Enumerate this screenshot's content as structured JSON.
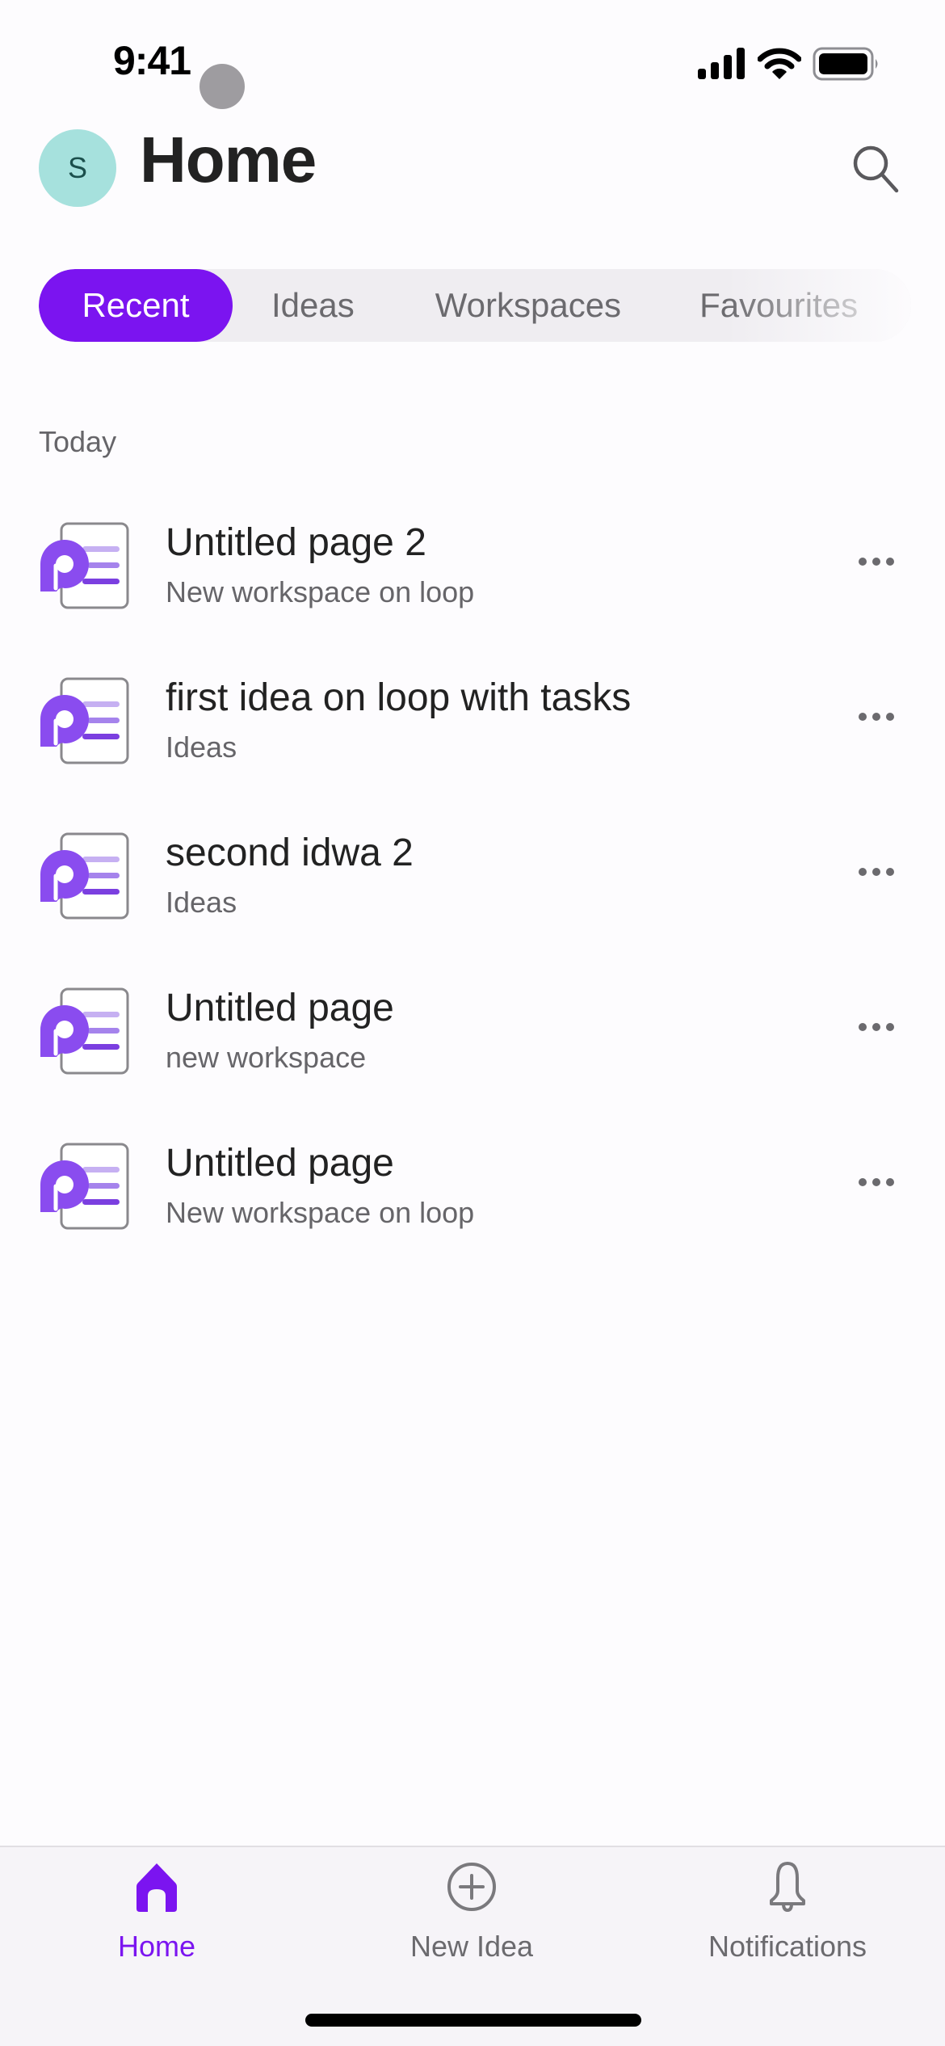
{
  "status_bar": {
    "time": "9:41",
    "icons": [
      "cellular-signal-icon",
      "wifi-icon",
      "battery-icon"
    ]
  },
  "header": {
    "avatar_initial": "S",
    "title": "Home",
    "search_icon": "search-icon"
  },
  "tabs": [
    {
      "label": "Recent",
      "active": true
    },
    {
      "label": "Ideas",
      "active": false
    },
    {
      "label": "Workspaces",
      "active": false
    },
    {
      "label": "Favourites",
      "active": false
    }
  ],
  "section": {
    "label": "Today"
  },
  "items": [
    {
      "title": "Untitled page 2",
      "subtitle": "New workspace on loop",
      "icon": "loop-page-icon"
    },
    {
      "title": "first idea on loop with tasks",
      "subtitle": "Ideas",
      "icon": "loop-page-icon"
    },
    {
      "title": "second idwa 2",
      "subtitle": "Ideas",
      "icon": "loop-page-icon"
    },
    {
      "title": "Untitled page",
      "subtitle": "new workspace",
      "icon": "loop-page-icon"
    },
    {
      "title": "Untitled page",
      "subtitle": "New workspace on loop",
      "icon": "loop-page-icon"
    }
  ],
  "bottom_nav": [
    {
      "label": "Home",
      "icon": "home-icon",
      "active": true
    },
    {
      "label": "New Idea",
      "icon": "add-circle-icon",
      "active": false
    },
    {
      "label": "Notifications",
      "icon": "bell-icon",
      "active": false
    }
  ],
  "colors": {
    "accent": "#7b14f0",
    "avatar_bg": "#a6e1dd",
    "tab_track": "#efedf1",
    "secondary_text": "#666569"
  }
}
